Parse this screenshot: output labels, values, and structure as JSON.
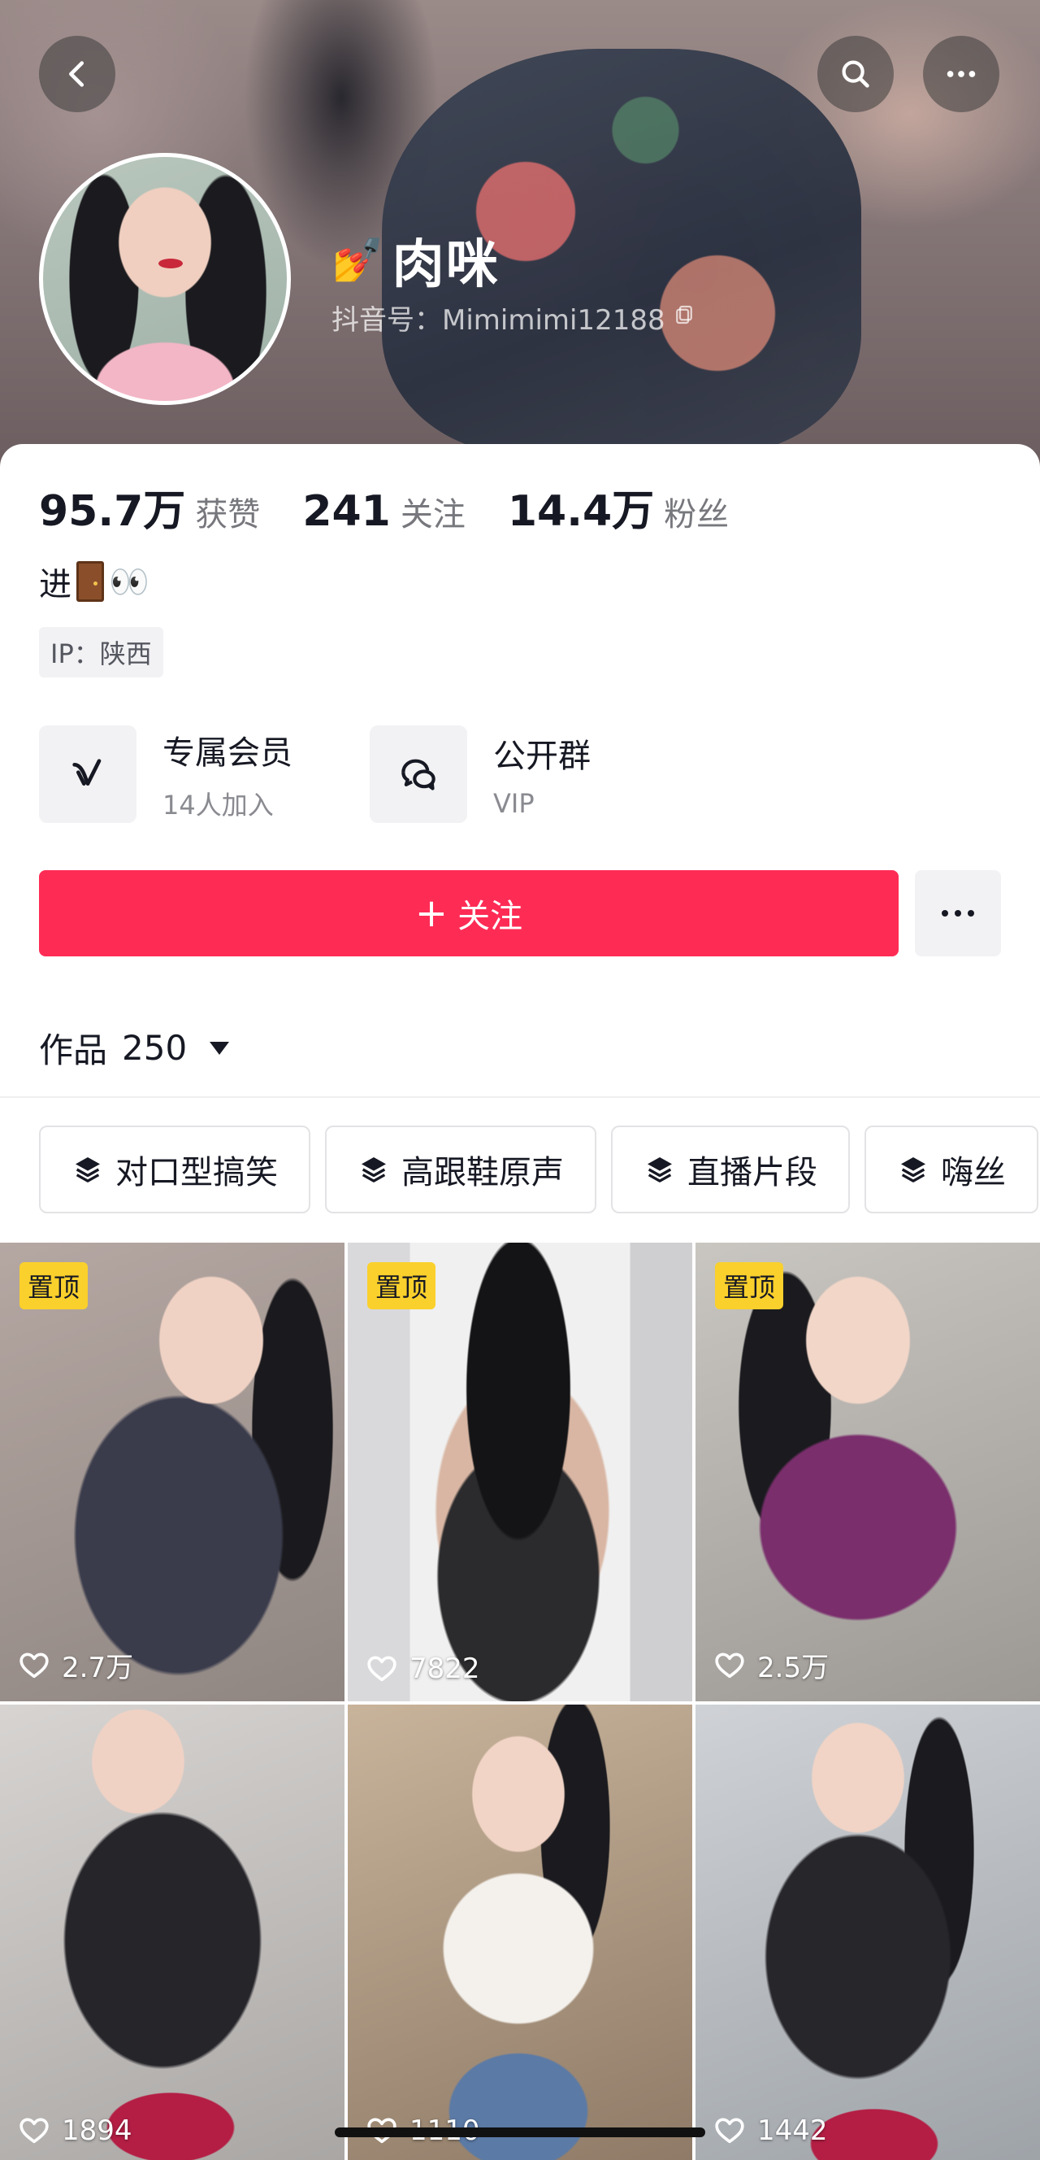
{
  "profile": {
    "name_emoji": "💅",
    "name": "肉咪",
    "douyin_id": "抖音号：Mimimimi12188"
  },
  "stats": [
    {
      "num": "95.7万",
      "label": "获赞"
    },
    {
      "num": "241",
      "label": "关注"
    },
    {
      "num": "14.4万",
      "label": "粉丝"
    }
  ],
  "bio": {
    "text": "进",
    "emoji": "👀"
  },
  "ip": "IP：陕西",
  "features": [
    {
      "title": "专属会员",
      "sub": "14人加入",
      "icon": "vip-v-icon"
    },
    {
      "title": "公开群",
      "sub": "VIP",
      "icon": "group-chat-icon"
    }
  ],
  "actions": {
    "follow_label": "关注",
    "follow_plus": "+"
  },
  "works": {
    "label": "作品",
    "count": "250"
  },
  "chips": [
    "对口型搞笑",
    "高跟鞋原声",
    "直播片段",
    "嗨丝"
  ],
  "videos": [
    {
      "pinned": true,
      "pin_label": "置顶",
      "likes": "2.7万"
    },
    {
      "pinned": true,
      "pin_label": "置顶",
      "likes": "7822"
    },
    {
      "pinned": true,
      "pin_label": "置顶",
      "likes": "2.5万"
    },
    {
      "pinned": false,
      "pin_label": "",
      "likes": "1894"
    },
    {
      "pinned": false,
      "pin_label": "",
      "likes": "1110"
    },
    {
      "pinned": false,
      "pin_label": "",
      "likes": "1442"
    }
  ],
  "colors": {
    "accent": "#fe2c55",
    "pin": "#fad02c",
    "text": "#161823",
    "muted": "#77787d"
  }
}
